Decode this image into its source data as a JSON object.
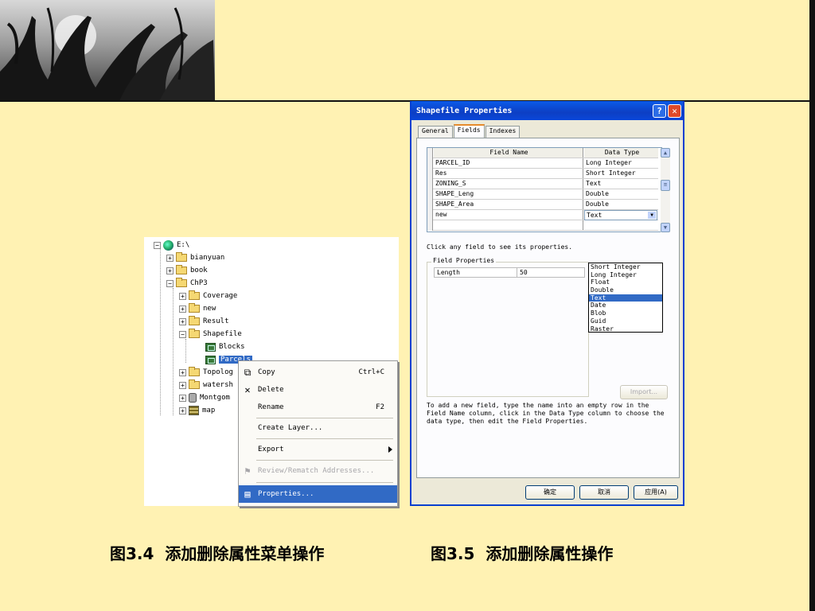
{
  "tree": {
    "root": "E:\\",
    "items": [
      "bianyuan",
      "book",
      "ChP3",
      "Coverage",
      "new",
      "Result",
      "Shapefile",
      "Blocks",
      "Parcels",
      "Topolog",
      "watersh",
      "Montgom",
      "map"
    ]
  },
  "context_menu": {
    "copy": "Copy",
    "copy_shortcut": "Ctrl+C",
    "delete": "Delete",
    "rename": "Rename",
    "rename_shortcut": "F2",
    "create_layer": "Create Layer...",
    "export": "Export",
    "review": "Review/Rematch Addresses...",
    "properties": "Properties..."
  },
  "dialog": {
    "title": "Shapefile Properties",
    "tabs": [
      "General",
      "Fields",
      "Indexes"
    ],
    "grid_headers": [
      "Field Name",
      "Data Type"
    ],
    "rows": [
      {
        "name": "PARCEL_ID",
        "type": "Long Integer"
      },
      {
        "name": "Res",
        "type": "Short Integer"
      },
      {
        "name": "ZONING_S",
        "type": "Text"
      },
      {
        "name": "SHAPE_Leng",
        "type": "Double"
      },
      {
        "name": "SHAPE_Area",
        "type": "Double"
      }
    ],
    "new_row_name": "new",
    "new_row_type": "Text",
    "type_options": [
      "Short Integer",
      "Long Integer",
      "Float",
      "Double",
      "Text",
      "Date",
      "Blob",
      "Guid",
      "Raster"
    ],
    "selected_option": "Text",
    "hint": "Click any field to see its properties.",
    "field_props_label": "Field Properties",
    "prop_name": "Length",
    "prop_value": "50",
    "import_button": "Import...",
    "help_text": "To add a new field, type the name into an empty row in the Field Name column, click in the Data Type column to choose the data type, then edit the Field Properties.",
    "ok": "确定",
    "cancel": "取消",
    "apply": "应用(A)"
  },
  "captions": {
    "left_num": "图3.4",
    "left_text": "添加删除属性菜单操作",
    "right_num": "图3.5",
    "right_text": "添加删除属性操作"
  }
}
